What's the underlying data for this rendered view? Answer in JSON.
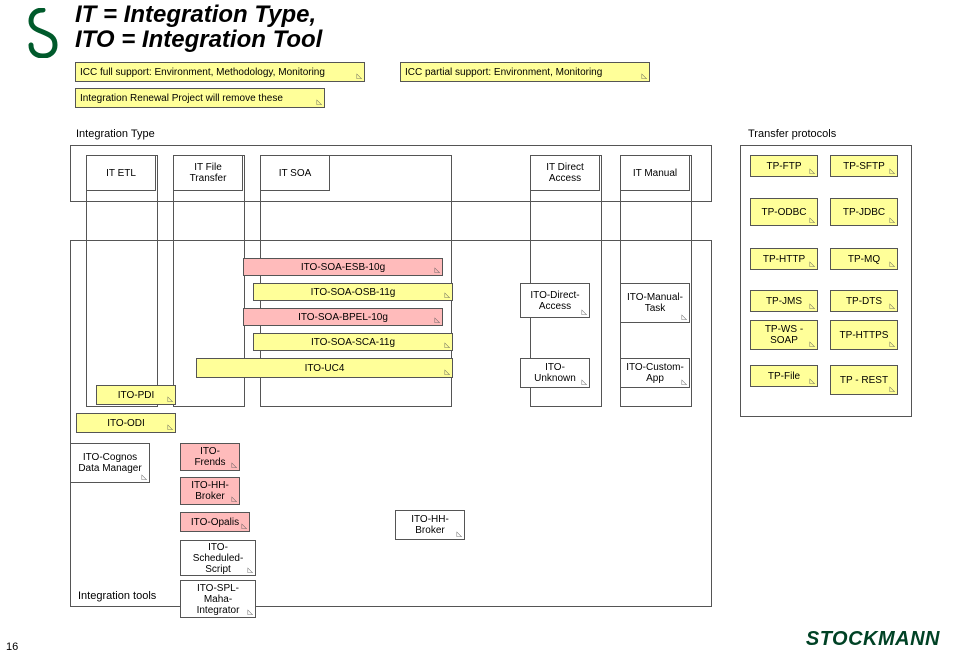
{
  "page_number": "16",
  "brand": "STOCKMANN",
  "title_line1": "IT = Integration Type,",
  "title_line2": "ITO = Integration Tool",
  "note_full": "ICC full support: Environment, Methodology, Monitoring",
  "note_partial": "ICC partial support: Environment, Monitoring",
  "note_remove": "Integration Renewal Project will remove these",
  "section_integration_type": "Integration Type",
  "section_transfer_protocols": "Transfer protocols",
  "section_integration_tools": "Integration tools",
  "it": {
    "etl": "IT ETL",
    "file": "IT File Transfer",
    "soa": "IT SOA",
    "direct": "IT Direct Access",
    "manual": "IT Manual"
  },
  "tp": {
    "ftp": "TP-FTP",
    "sftp": "TP-SFTP",
    "odbc": "TP-ODBC",
    "jdbc": "TP-JDBC",
    "http": "TP-HTTP",
    "mq": "TP-MQ",
    "jms": "TP-JMS",
    "dts": "TP-DTS",
    "ws": "TP-WS - SOAP",
    "https": "TP-HTTPS",
    "file": "TP-File",
    "rest": "TP - REST"
  },
  "ito": {
    "esb10g": "ITO-SOA-ESB-10g",
    "osb11g": "ITO-SOA-OSB-11g",
    "bpel10g": "ITO-SOA-BPEL-10g",
    "sca11g": "ITO-SOA-SCA-11g",
    "uc4": "ITO-UC4",
    "pdi": "ITO-PDI",
    "odi": "ITO-ODI",
    "direct": "ITO-Direct-Access",
    "manual": "ITO-Manual-Task",
    "unknown": "ITO-Unknown",
    "custom": "ITO-Custom-App",
    "cognos": "ITO-Cognos Data Manager",
    "frends": "ITO-Frends",
    "hhbroker": "ITO-HH-Broker",
    "opalis": "ITO-Opalis",
    "scheduled": "ITO-Scheduled-Script",
    "spl": "ITO-SPL-Maha-Integrator",
    "hhbroker2": "ITO-HH-Broker"
  }
}
